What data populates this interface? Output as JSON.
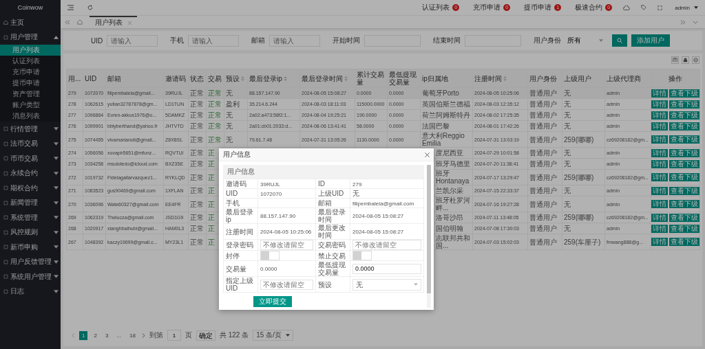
{
  "sidebar": {
    "brand": "Coinwow",
    "items": [
      {
        "label": "主页"
      },
      {
        "label": "用户管理",
        "expanded": true,
        "children": [
          {
            "label": "用户列表",
            "selected": true
          },
          {
            "label": "认证列表",
            "selected": false
          },
          {
            "label": "充币申请",
            "selected": false
          },
          {
            "label": "提币申请",
            "selected": false
          },
          {
            "label": "资产管理",
            "selected": false
          },
          {
            "label": "账户类型",
            "selected": false
          },
          {
            "label": "消息列表",
            "selected": false
          }
        ]
      },
      {
        "label": "行情管理",
        "expanded": false
      },
      {
        "label": "法币交易",
        "expanded": false
      },
      {
        "label": "币币交易",
        "expanded": false
      },
      {
        "label": "永续合约",
        "expanded": false
      },
      {
        "label": "期权合约",
        "expanded": false
      },
      {
        "label": "新闻管理",
        "expanded": false
      },
      {
        "label": "系统管理",
        "expanded": false
      },
      {
        "label": "风控规则",
        "expanded": false
      },
      {
        "label": "新币申购",
        "expanded": false
      },
      {
        "label": "用户反馈管理",
        "expanded": false
      },
      {
        "label": "系统用户管理",
        "expanded": false
      },
      {
        "label": "日志",
        "expanded": false
      }
    ]
  },
  "header": {
    "notices": [
      {
        "label": "认证列表",
        "count": "0"
      },
      {
        "label": "充币申请",
        "count": "0"
      },
      {
        "label": "提币申请",
        "count": "1"
      },
      {
        "label": "极速合约",
        "count": "0"
      }
    ],
    "user": "admin"
  },
  "tabs": [
    {
      "label": "用户列表",
      "selected": true
    }
  ],
  "filters": [
    {
      "kind": "text",
      "label": "UID",
      "placeholder": "请输入"
    },
    {
      "kind": "text",
      "label": "手机",
      "placeholder": "请输入"
    },
    {
      "kind": "text",
      "label": "邮箱",
      "placeholder": "请输入"
    },
    {
      "kind": "date",
      "label": "开始时间"
    },
    {
      "kind": "date",
      "label": "结束时间"
    },
    {
      "kind": "select",
      "label": "用户身份",
      "value": "所有"
    }
  ],
  "add_button": "添加用户",
  "table": {
    "columns": [
      {
        "label": "用...",
        "sortable": false
      },
      {
        "label": "UID",
        "sortable": false
      },
      {
        "label": "邮箱",
        "sortable": false
      },
      {
        "label": "邀请码",
        "sortable": false
      },
      {
        "label": "状态",
        "sortable": false
      },
      {
        "label": "交易",
        "sortable": false
      },
      {
        "label": "预设",
        "sortable": true
      },
      {
        "label": "最后登录ip",
        "sortable": true
      },
      {
        "label": "最后登录时间",
        "sortable": true
      },
      {
        "label": "累计交易量",
        "sortable": false
      },
      {
        "label": "最低提现交易量",
        "sortable": false
      },
      {
        "label": "ip归属地",
        "sortable": false
      },
      {
        "label": "注册时间",
        "sortable": true
      },
      {
        "label": "用户身份",
        "sortable": false
      },
      {
        "label": "上级用户",
        "sortable": false
      },
      {
        "label": "上级代理商",
        "sortable": false
      },
      {
        "label": "操作",
        "sortable": false
      }
    ],
    "rows": [
      {
        "cells": [
          "279",
          "1072070",
          "filipembaleia@gmail...",
          "39RUJL",
          "正常",
          "正常",
          "无",
          "88.157.147.90",
          "2024-08-05 15:08:27",
          "0.0000",
          "0.0000",
          "葡萄牙Porto",
          "2024-08-05 10:25:06",
          "普通用户",
          "无",
          "admin"
        ],
        "actions": [
          "详情",
          "查看下级"
        ]
      },
      {
        "cells": [
          "278",
          "1062615",
          "yutian32787878@gm...",
          "LD1TUN",
          "正常",
          "正常",
          "盈利",
          "35.214.6.244",
          "2024-08-03 18:11:03",
          "115000.0000",
          "0.0000",
          "英国伯斯兰德福",
          "2024-08-03 12:35:12",
          "普通用户",
          "无",
          "admin"
        ],
        "actions": [
          "详情",
          "查看下级"
        ]
      },
      {
        "cells": [
          "277",
          "1096864",
          "Evren-akkus1976@o...",
          "5DAMKZ",
          "正常",
          "正常",
          "无",
          "2a02:a473:58f2:1...",
          "2024-08-04 19:25:21",
          "190.0000",
          "0.0000",
          "荷兰阿姆斯特丹",
          "2024-08-02 17:25:35",
          "普通用户",
          "无",
          "admin"
        ],
        "actions": [
          "详情",
          "查看下级"
        ]
      },
      {
        "cells": [
          "276",
          "1099901",
          "bblyberthand@yahoo.fr",
          "JHTVTD",
          "正常",
          "正常",
          "无",
          "2a01:cb01:2033:d...",
          "2024-08-06 13:41:41",
          "58.0000",
          "0.0000",
          "法国巴黎",
          "2024-08-01 17:42:26",
          "普通用户",
          "无",
          "admin"
        ],
        "actions": [
          "详情",
          "查看下级"
        ]
      },
      {
        "cells": [
          "275",
          "1074455",
          "vivamarianoli@gmail...",
          "Z8X8SL",
          "正常",
          "正常",
          "无",
          "79.61.7.48",
          "2024-07-31 13:05:26",
          "1130.0000",
          "0.0000",
          "意大利Reggio Emilia",
          "2024-07-31 13:03:19",
          "普通用户",
          "259(哪哪)",
          "cz69208182@gm..."
        ],
        "actions": [
          "详情",
          "查看下级"
        ]
      },
      {
        "cells": [
          "274",
          "1056056",
          "xovapir5651@mfunz...",
          "RQVTUI",
          "正常",
          "正",
          null,
          null,
          null,
          null,
          null,
          "度尼西亚",
          "2024-07-29 10:01:58",
          "普通用户",
          "无",
          "admin"
        ],
        "actions": [
          "详情",
          "查看下级"
        ]
      },
      {
        "cells": [
          "273",
          "1034258",
          "msulotedo@icloud.com",
          "BXZ35E",
          "正常",
          "正",
          null,
          null,
          null,
          null,
          null,
          "班牙马德里",
          "2024-07-20 11:38:41",
          "普通用户",
          "无",
          "admin"
        ],
        "actions": [
          "详情",
          "查看下级"
        ]
      },
      {
        "cells": [
          "272",
          "1019732",
          "Fidelagallarvazquez1...",
          "RYKLQD",
          "正常",
          "正",
          null,
          null,
          null,
          null,
          null,
          "班牙Hontanaya",
          "2024-07-17 13:29:47",
          "普通用户",
          "259(哪哪)",
          "cz69208182@gm..."
        ],
        "actions": [
          "详情",
          "查看下级"
        ]
      },
      {
        "cells": [
          "271",
          "1083523",
          "gus90469@gmail.com",
          "1XFLAN",
          "正常",
          "正",
          null,
          null,
          null,
          null,
          null,
          "兰凯尔采",
          "2024-07-15 22:33:37",
          "普通用户",
          "无",
          "admin"
        ],
        "actions": [
          "详情",
          "查看下级"
        ]
      },
      {
        "cells": [
          "270",
          "1036096",
          "Wate60327@gmail.com",
          "EE4FR",
          "正常",
          "正",
          null,
          null,
          null,
          null,
          null,
          "班牙杜罗河畔...",
          "2024-07-16 19:27:28",
          "普通用户",
          "无",
          "admin"
        ],
        "actions": [
          "详情",
          "查看下级"
        ]
      },
      {
        "cells": [
          "269",
          "1062319",
          "Thelucza@gmail.com",
          "JSD1G9",
          "正常",
          "正",
          null,
          null,
          null,
          null,
          null,
          "洛哥沙昂",
          "2024-07-11 13:48:05",
          "普通用户",
          "259(哪哪)",
          "cz69208182@gm..."
        ],
        "actions": [
          "详情",
          "查看下级"
        ]
      },
      {
        "cells": [
          "268",
          "1020917",
          "xianghbaihubi@gmail...",
          "HAM0L3",
          "正常",
          "正",
          null,
          null,
          null,
          null,
          null,
          "国伯明翰",
          "2024-07-08 17:30:03",
          "普通用户",
          "无",
          "admin"
        ],
        "actions": [
          "详情",
          "查看下级"
        ]
      },
      {
        "cells": [
          "267",
          "1048392",
          "kaczy19699@gmail.c...",
          "MY23L1",
          "正常",
          "正",
          null,
          null,
          null,
          null,
          null,
          "志联邦共和国...",
          "2024-07-03 15:02:03",
          "普通用户",
          "259(车厘子)",
          "fmwang888@g..."
        ],
        "actions": [
          "详情",
          "查看下级"
        ]
      }
    ]
  },
  "pagination": {
    "pages": [
      {
        "label": "1",
        "selected": true
      },
      {
        "label": "2",
        "selected": false
      },
      {
        "label": "3",
        "selected": false
      },
      {
        "label": "...",
        "selected": false
      },
      {
        "label": "18",
        "selected": false
      }
    ],
    "goto_label": "到第",
    "goto_value": "1",
    "goto_unit": "页",
    "confirm": "确定",
    "total": "共 122 条",
    "page_size": "15 条/页"
  },
  "modal": {
    "title": "用户信息",
    "section": "用户信息",
    "rows": [
      [
        {
          "label": "邀请码",
          "kind": "text",
          "value": "39RUJL"
        },
        {
          "label": "ID",
          "kind": "text",
          "value": "279"
        }
      ],
      [
        {
          "label": "UID",
          "kind": "text",
          "value": "1072070"
        },
        {
          "label": "上级UID",
          "kind": "text",
          "value": "无"
        }
      ],
      [
        {
          "label": "手机",
          "kind": "text"
        },
        {
          "label": "邮箱",
          "kind": "text",
          "value": "filipembaleia@gmail.com"
        }
      ],
      [
        {
          "label": "最后登录ip",
          "kind": "text",
          "value": "88.157.147.90"
        },
        {
          "label": "最后登录时间",
          "kind": "text",
          "value": "2024-08-05 15:08:27"
        }
      ],
      [
        {
          "label": "注册时间",
          "kind": "text",
          "value": "2024-08-05 10:25:06"
        },
        {
          "label": "最后更改时间",
          "kind": "text",
          "value": "2024-08-05 15:08:27"
        }
      ],
      [
        {
          "label": "登录密码",
          "kind": "input",
          "placeholder": "不修改请留空"
        },
        {
          "label": "交易密码",
          "kind": "input",
          "placeholder": "不修改请留空"
        }
      ],
      [
        {
          "label": "封停",
          "kind": "toggle",
          "on": false
        },
        {
          "label": "禁止交易",
          "kind": "toggle",
          "on": false
        }
      ],
      [
        {
          "label": "交易量",
          "kind": "text",
          "value": "0.0000"
        },
        {
          "label": "最低提现交易量",
          "kind": "input",
          "value": "0.0000"
        }
      ],
      [
        {
          "label": "指定上级UID",
          "kind": "input",
          "placeholder": "不修改请留空"
        },
        {
          "label": "预设",
          "kind": "select",
          "value": "无"
        }
      ]
    ],
    "submit": "立即提交"
  }
}
